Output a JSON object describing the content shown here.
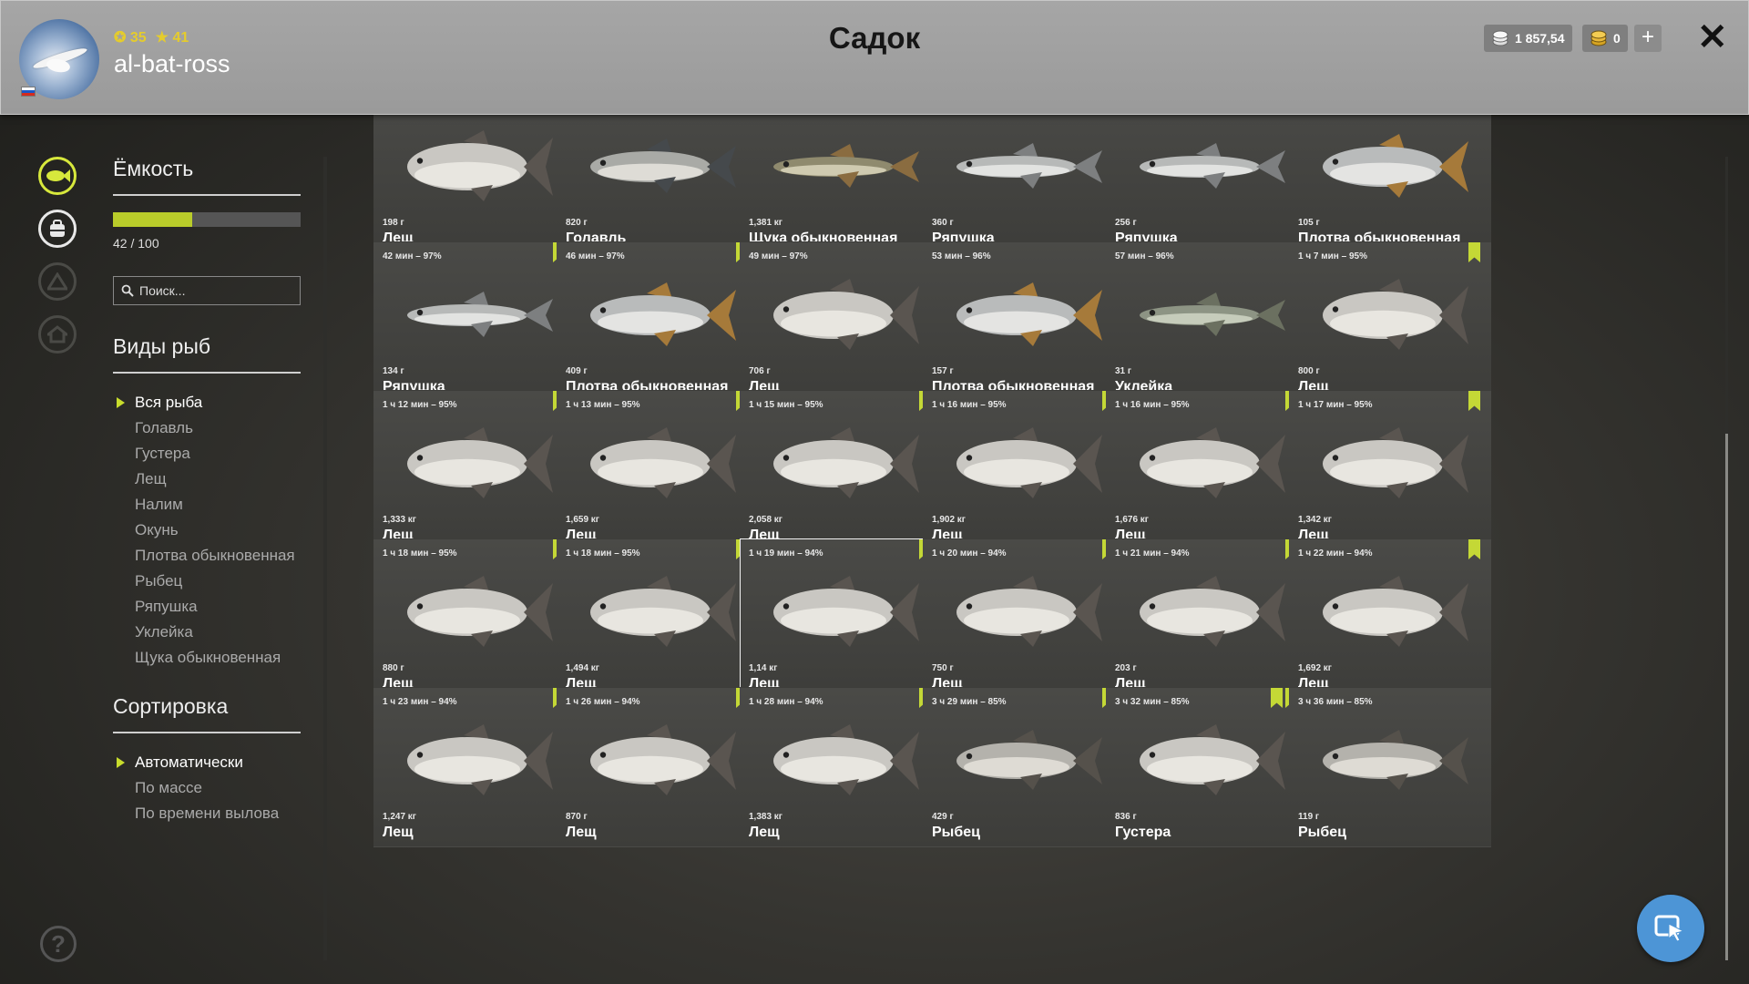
{
  "header": {
    "title": "Садок",
    "level": "35",
    "stars": "41",
    "username": "al-bat-ross",
    "silver": "1 857,54",
    "gold": "0"
  },
  "sidebar": {
    "capacity_title": "Ёмкость",
    "capacity_text": "42 / 100",
    "capacity_fraction": 0.42,
    "search_placeholder": "Поиск...",
    "species_title": "Виды рыб",
    "species": [
      "Вся рыба",
      "Голавль",
      "Густера",
      "Лещ",
      "Налим",
      "Окунь",
      "Плотва обыкновенная",
      "Рыбец",
      "Ряпушка",
      "Уклейка",
      "Щука обыкновенная"
    ],
    "sort_title": "Сортировка",
    "sort_options": [
      "Автоматически",
      "По массе",
      "По времени вылова"
    ]
  },
  "cards": [
    {
      "time": "",
      "weight": "198 г",
      "name": "Лещ",
      "marks": 0,
      "fish": "bream"
    },
    {
      "time": "",
      "weight": "820 г",
      "name": "Голавль",
      "marks": 0,
      "fish": "chub"
    },
    {
      "time": "",
      "weight": "1,381 кг",
      "name": "Щука обыкновенная",
      "marks": 0,
      "fish": "pike"
    },
    {
      "time": "",
      "weight": "360 г",
      "name": "Ряпушка",
      "marks": 0,
      "fish": "slim"
    },
    {
      "time": "",
      "weight": "256 г",
      "name": "Ряпушка",
      "marks": 0,
      "fish": "slim"
    },
    {
      "time": "",
      "weight": "105 г",
      "name": "Плотва обыкновенная",
      "marks": 0,
      "fish": "roach"
    },
    {
      "time": "42 мин – 97%",
      "weight": "134 г",
      "name": "Ряпушка",
      "marks": 1,
      "fish": "slim"
    },
    {
      "time": "46 мин – 97%",
      "weight": "409 г",
      "name": "Плотва обыкновенная",
      "marks": 1,
      "fish": "roach"
    },
    {
      "time": "49 мин – 97%",
      "weight": "706 г",
      "name": "Лещ",
      "marks": 0,
      "fish": "bream"
    },
    {
      "time": "53 мин – 96%",
      "weight": "157 г",
      "name": "Плотва обыкновенная",
      "marks": 0,
      "fish": "roach"
    },
    {
      "time": "57 мин – 96%",
      "weight": "31 г",
      "name": "Уклейка",
      "marks": 0,
      "fish": "bleak"
    },
    {
      "time": "1 ч 7 мин – 95%",
      "weight": "800 г",
      "name": "Лещ",
      "marks": 1,
      "fish": "bream"
    },
    {
      "time": "1 ч 12 мин – 95%",
      "weight": "1,333 кг",
      "name": "Лещ",
      "marks": 1,
      "fish": "bream"
    },
    {
      "time": "1 ч 13 мин – 95%",
      "weight": "1,659 кг",
      "name": "Лещ",
      "marks": 1,
      "fish": "bream"
    },
    {
      "time": "1 ч 15 мин – 95%",
      "weight": "2,058 кг",
      "name": "Лещ",
      "marks": 1,
      "fish": "bream"
    },
    {
      "time": "1 ч 16 мин – 95%",
      "weight": "1,902 кг",
      "name": "Лещ",
      "marks": 1,
      "fish": "bream"
    },
    {
      "time": "1 ч 16 мин – 95%",
      "weight": "1,676 кг",
      "name": "Лещ",
      "marks": 1,
      "fish": "bream"
    },
    {
      "time": "1 ч 17 мин – 95%",
      "weight": "1,342 кг",
      "name": "Лещ",
      "marks": 1,
      "fish": "bream"
    },
    {
      "time": "1 ч 18 мин – 95%",
      "weight": "880 г",
      "name": "Лещ",
      "marks": 1,
      "fish": "bream"
    },
    {
      "time": "1 ч 18 мин – 95%",
      "weight": "1,494 кг",
      "name": "Лещ",
      "marks": 1,
      "fish": "bream"
    },
    {
      "time": "1 ч 19 мин – 94%",
      "weight": "1,14 кг",
      "name": "Лещ",
      "marks": 1,
      "fish": "bream",
      "selected": true
    },
    {
      "time": "1 ч 20 мин – 94%",
      "weight": "750 г",
      "name": "Лещ",
      "marks": 1,
      "fish": "bream"
    },
    {
      "time": "1 ч 21 мин – 94%",
      "weight": "203 г",
      "name": "Лещ",
      "marks": 1,
      "fish": "bream"
    },
    {
      "time": "1 ч 22 мин – 94%",
      "weight": "1,692 кг",
      "name": "Лещ",
      "marks": 1,
      "fish": "bream"
    },
    {
      "time": "1 ч 23 мин – 94%",
      "weight": "1,247 кг",
      "name": "Лещ",
      "marks": 1,
      "fish": "bream"
    },
    {
      "time": "1 ч 26 мин – 94%",
      "weight": "870 г",
      "name": "Лещ",
      "marks": 1,
      "fish": "bream"
    },
    {
      "time": "1 ч 28 мин – 94%",
      "weight": "1,383 кг",
      "name": "Лещ",
      "marks": 1,
      "fish": "bream"
    },
    {
      "time": "3 ч 29 мин – 85%",
      "weight": "429 г",
      "name": "Рыбец",
      "marks": 1,
      "fish": "vimba"
    },
    {
      "time": "3 ч 32 мин – 85%",
      "weight": "836 г",
      "name": "Густера",
      "marks": 2,
      "fish": "bream"
    },
    {
      "time": "3 ч 36 мин – 85%",
      "weight": "119 г",
      "name": "Рыбец",
      "marks": 0,
      "fish": "vimba"
    }
  ],
  "icons": {
    "level": "leaf-circle-icon",
    "stars": "star-icon",
    "silver": "silver-coins-icon",
    "gold": "gold-coins-icon",
    "keepnet": "fish-circle-icon",
    "bag": "bag-icon",
    "home": "home-icon",
    "camp": "camp-icon",
    "help": "help-icon",
    "fab": "cursor-icon"
  },
  "colors": {
    "accent": "#c4d836",
    "fab": "#4d95d6"
  }
}
